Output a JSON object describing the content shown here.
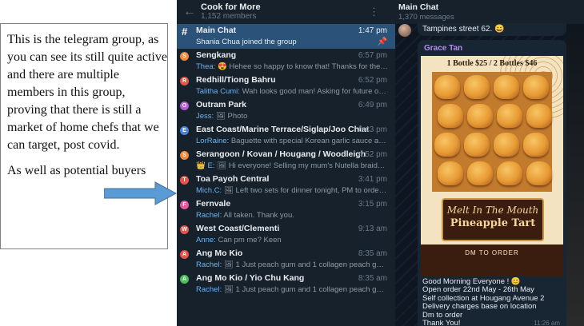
{
  "annotation": {
    "paragraph1": "This is the telegram group, as you can see its still quite active and there are multiple members in this group, proving that there is still a market of home chefs that we can target, post covid.",
    "paragraph2": "As well as potential buyers",
    "arrow_color": "#5b9bd5"
  },
  "group_header": {
    "title": "Cook for More",
    "members": "1,152 members"
  },
  "chats": [
    {
      "title": "Main Chat",
      "time": "1:47 pm",
      "sender": "",
      "preview": "Shania Chua joined the group",
      "badge": "#",
      "color": "#ffffff",
      "active": true
    },
    {
      "title": "Sengkang",
      "time": "6:57 pm",
      "sender": "Thea:",
      "preview": "😍 Hehee so happy to know that! Thanks for the love!",
      "badge": "S",
      "color": "#f0883e"
    },
    {
      "title": "Redhill/Tiong Bahru",
      "time": "6:52 pm",
      "sender": "Talitha Cumi:",
      "preview": "Wah looks good man! Asking for future orders ...",
      "badge": "R",
      "color": "#e5534b"
    },
    {
      "title": "Outram Park",
      "time": "6:49 pm",
      "sender": "Jess:",
      "preview": "🖼 Photo",
      "badge": "O",
      "color": "#b45cd3"
    },
    {
      "title": "East Coast/Marine Terrace/Siglap/Joo Chiat",
      "time": "6:43 pm",
      "sender": "LorRaine:",
      "preview": "Baguette with special Korean garlic sauce and moz...",
      "badge": "E",
      "color": "#3f8ae0"
    },
    {
      "title": "Serangoon / Kovan / Hougang / Woodleigh",
      "time": "4:52 pm",
      "sender": "👑 E:",
      "preview": "🖼 Hi everyone! Selling my mum's Nutella braids! Can ...",
      "badge": "S",
      "color": "#f0883e"
    },
    {
      "title": "Toa Payoh Central",
      "time": "3:41 pm",
      "sender": "Mich.C:",
      "preview": "🖼 Left two sets for dinner tonight, PM to order 😋",
      "badge": "T",
      "color": "#e5534b"
    },
    {
      "title": "Fernvale",
      "time": "3:15 pm",
      "sender": "Rachel:",
      "preview": "All taken. Thank you.",
      "badge": "F",
      "color": "#e557a0"
    },
    {
      "title": "West Coast/Clementi",
      "time": "9:13 am",
      "sender": "Anne:",
      "preview": "Can pm me? Keen",
      "badge": "W",
      "color": "#e5534b"
    },
    {
      "title": "Ang Mo Kio",
      "time": "8:35 am",
      "sender": "Rachel:",
      "preview": "🖼 1 Just peach gum and 1 collagen peach gum avail...",
      "badge": "A",
      "color": "#e5534b"
    },
    {
      "title": "Ang Mo Kio / Yio Chu Kang",
      "time": "8:35 am",
      "sender": "Rachel:",
      "preview": "🖼 1 Just peach gum and 1 collagen peach gum avail...",
      "badge": "A",
      "color": "#4cbf5b"
    }
  ],
  "chat_header": {
    "title": "Main Chat",
    "count": "1,370 messages"
  },
  "top_message": "Tampines street 62. 😄",
  "post": {
    "author": "Grace Tan",
    "price_line": "1 Bottle $25 / 2 Bottles $46",
    "banner_script": "Melt In The Mouth",
    "banner_title": "Pineapple Tart",
    "dm_label": "DM TO ORDER",
    "lines": [
      "Good Morning Everyone ! 😊",
      "Open order 22nd May - 26th May",
      "Self collection at Hougang Avenue 2",
      "Delivery charges base on location",
      "Dm to order",
      "Thank You!"
    ],
    "time": "11:26 am"
  }
}
